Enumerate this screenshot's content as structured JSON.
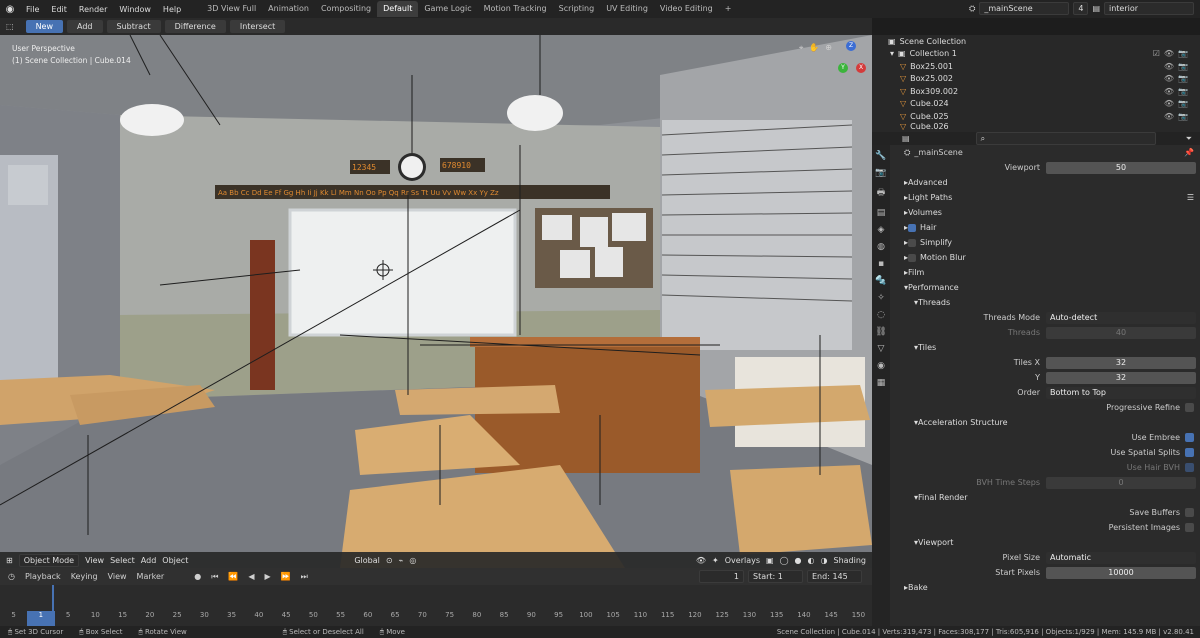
{
  "menu": {
    "items": [
      "File",
      "Edit",
      "Render",
      "Window",
      "Help"
    ]
  },
  "workspaces": [
    "3D View Full",
    "Animation",
    "Compositing",
    "Default",
    "Game Logic",
    "Motion Tracking",
    "Scripting",
    "UV Editing",
    "Video Editing"
  ],
  "scene": {
    "name": "_mainScene",
    "users": "4",
    "view_layer": "interior"
  },
  "tools": {
    "new": "New",
    "add": "Add",
    "subtract": "Subtract",
    "difference": "Difference",
    "intersect": "Intersect"
  },
  "viewport": {
    "title": "User Perspective",
    "context": "(1) Scene Collection | Cube.014",
    "mode": "Object Mode",
    "menus": [
      "View",
      "Select",
      "Add",
      "Object"
    ],
    "orientation": "Global",
    "overlays": "Overlays",
    "shading": "Shading",
    "axes": {
      "x": "X",
      "y": "Y",
      "z": "Z"
    }
  },
  "scene_text": {
    "clock_left": "12345",
    "clock_right": "678910",
    "alphabet": "Aa Bb Cc Dd Ee Ff Gg Hh Ii Jj Kk Ll Mm Nn Oo Pp Qq Rr Ss Tt Uu Vv Ww Xx Yy Zz"
  },
  "timeline": {
    "menus": [
      "Playback",
      "Keying",
      "View",
      "Marker"
    ],
    "current_frame": "1",
    "start_label": "Start:",
    "start": "1",
    "end_label": "End:",
    "end": "145",
    "ruler": [
      "5",
      "1",
      "5",
      "10",
      "15",
      "20",
      "25",
      "30",
      "35",
      "40",
      "45",
      "50",
      "55",
      "60",
      "65",
      "70",
      "75",
      "80",
      "85",
      "90",
      "95",
      "100",
      "105",
      "110",
      "115",
      "120",
      "125",
      "130",
      "135",
      "140",
      "145",
      "150"
    ]
  },
  "outliner": {
    "root": "Scene Collection",
    "collection": "Collection 1",
    "items": [
      "Box25.001",
      "Box25.002",
      "Box309.002",
      "Cube.024",
      "Cube.025",
      "Cube.026"
    ]
  },
  "props": {
    "scene_name": "_mainScene",
    "viewport": {
      "label": "Viewport",
      "value": "50"
    },
    "sections": {
      "advanced": "Advanced",
      "light_paths": "Light Paths",
      "volumes": "Volumes",
      "hair": "Hair",
      "simplify": "Simplify",
      "motion_blur": "Motion Blur",
      "film": "Film",
      "performance": "Performance",
      "threads": "Threads",
      "tiles": "Tiles",
      "accel": "Acceleration Structure",
      "final_render": "Final Render",
      "viewport2": "Viewport",
      "bake": "Bake"
    },
    "threads_mode": {
      "label": "Threads Mode",
      "value": "Auto-detect"
    },
    "threads": {
      "label": "Threads",
      "value": "40"
    },
    "tiles_x": {
      "label": "Tiles X",
      "value": "32"
    },
    "tiles_y": {
      "label": "Y",
      "value": "32"
    },
    "order": {
      "label": "Order",
      "value": "Bottom to Top"
    },
    "progressive_refine": "Progressive Refine",
    "use_embree": "Use Embree",
    "use_spatial_splits": "Use Spatial Splits",
    "use_hair_bvh": "Use Hair BVH",
    "bvh_time_steps": {
      "label": "BVH Time Steps",
      "value": "0"
    },
    "save_buffers": "Save Buffers",
    "persistent_images": "Persistent Images",
    "pixel_size": {
      "label": "Pixel Size",
      "value": "Automatic"
    },
    "start_pixels": {
      "label": "Start Pixels",
      "value": "10000"
    }
  },
  "status": {
    "set_cursor": "Set 3D Cursor",
    "box_select": "Box Select",
    "rotate": "Rotate View",
    "select_deselect": "Select or Deselect All",
    "move": "Move",
    "stats": "Scene Collection | Cube.014 | Verts:319,473 | Faces:308,177 | Tris:605,916 | Objects:1/929 | Mem: 145.9 MB | v2.80.41"
  }
}
